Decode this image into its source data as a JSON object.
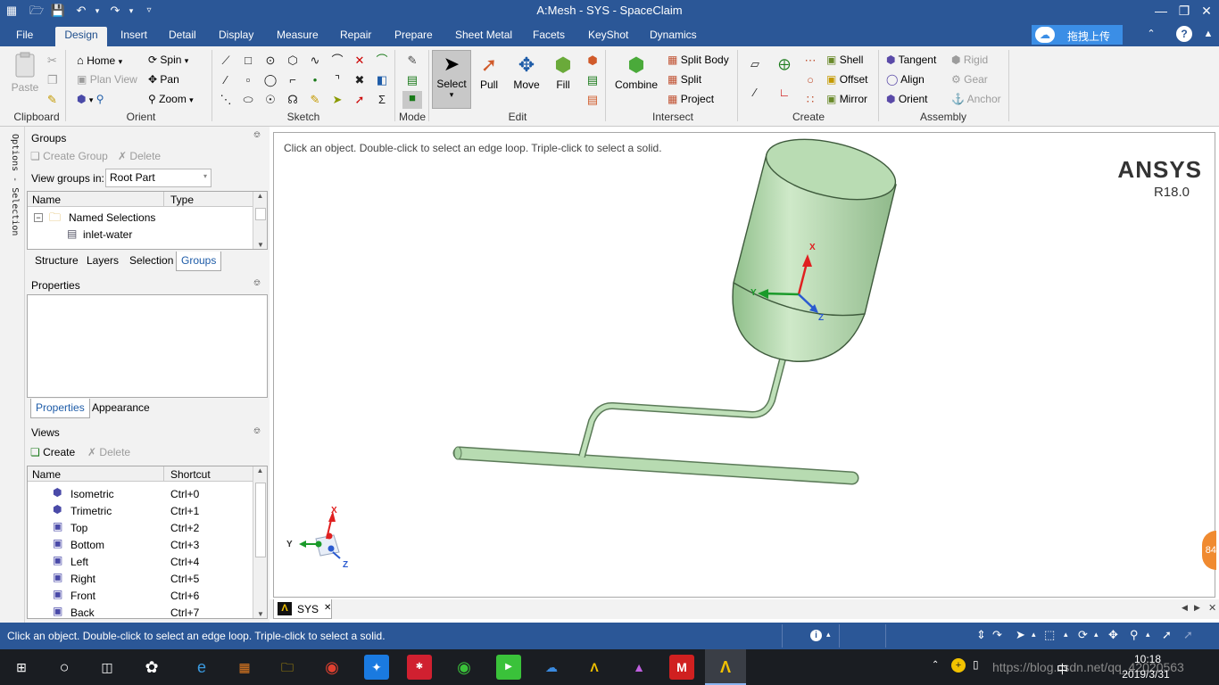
{
  "window": {
    "title": "A:Mesh - SYS - SpaceClaim"
  },
  "menu": {
    "tabs": [
      "File",
      "Design",
      "Insert",
      "Detail",
      "Display",
      "Measure",
      "Repair",
      "Prepare",
      "Sheet Metal",
      "Facets",
      "KeyShot",
      "Dynamics"
    ],
    "active": "Design",
    "upload_label": "拖拽上传"
  },
  "ribbon": {
    "clipboard": {
      "paste": "Paste",
      "group": "Clipboard"
    },
    "orient": {
      "home": "Home",
      "plan_view": "Plan View",
      "spin": "Spin",
      "pan": "Pan",
      "zoom": "Zoom",
      "group": "Orient"
    },
    "sketch": {
      "group": "Sketch"
    },
    "mode": {
      "group": "Mode"
    },
    "edit": {
      "select": "Select",
      "pull": "Pull",
      "move": "Move",
      "fill": "Fill",
      "group": "Edit"
    },
    "intersect": {
      "combine": "Combine",
      "split_body": "Split Body",
      "split": "Split",
      "project": "Project",
      "group": "Intersect"
    },
    "create": {
      "shell": "Shell",
      "offset": "Offset",
      "mirror": "Mirror",
      "group": "Create"
    },
    "assembly": {
      "tangent": "Tangent",
      "align": "Align",
      "orient": "Orient",
      "rigid": "Rigid",
      "gear": "Gear",
      "anchor": "Anchor",
      "group": "Assembly"
    }
  },
  "left": {
    "strip_label": "Options - Selection",
    "groups": {
      "title": "Groups",
      "create": "Create Group",
      "delete": "Delete",
      "view_in_label": "View groups in:",
      "view_in_value": "Root Part",
      "col_name": "Name",
      "col_type": "Type",
      "root": "Named Selections",
      "items": [
        "inlet-water"
      ]
    },
    "tabs": [
      "Structure",
      "Layers",
      "Selection",
      "Groups"
    ],
    "tabs_active": "Groups",
    "properties": {
      "title": "Properties",
      "tabs": [
        "Properties",
        "Appearance"
      ],
      "active": "Properties"
    },
    "views": {
      "title": "Views",
      "create": "Create",
      "delete": "Delete",
      "col_name": "Name",
      "col_shortcut": "Shortcut",
      "rows": [
        {
          "name": "Isometric",
          "shortcut": "Ctrl+0"
        },
        {
          "name": "Trimetric",
          "shortcut": "Ctrl+1"
        },
        {
          "name": "Top",
          "shortcut": "Ctrl+2"
        },
        {
          "name": "Bottom",
          "shortcut": "Ctrl+3"
        },
        {
          "name": "Left",
          "shortcut": "Ctrl+4"
        },
        {
          "name": "Right",
          "shortcut": "Ctrl+5"
        },
        {
          "name": "Front",
          "shortcut": "Ctrl+6"
        },
        {
          "name": "Back",
          "shortcut": "Ctrl+7"
        }
      ]
    }
  },
  "viewport": {
    "hint": "Click an object. Double-click to select an edge loop. Triple-click to select a solid.",
    "brand": "ANSYS",
    "version": "R18.0",
    "axes": {
      "x": "X",
      "y": "Y",
      "z": "Z"
    },
    "badge": "84"
  },
  "doc_tab": {
    "label": "SYS"
  },
  "status": {
    "text": "Click an object. Double-click to select an edge loop. Triple-click to select a solid."
  },
  "taskbar": {
    "time": "10:18",
    "date": "2019/3/31",
    "ime": "中",
    "watermark": "https://blog.csdn.net/qq_42020563"
  },
  "colors": {
    "titlebar": "#2b5797",
    "ribbon": "#f2f2f2",
    "model": "#a9d2a4",
    "accent": "#1e5ca8"
  }
}
